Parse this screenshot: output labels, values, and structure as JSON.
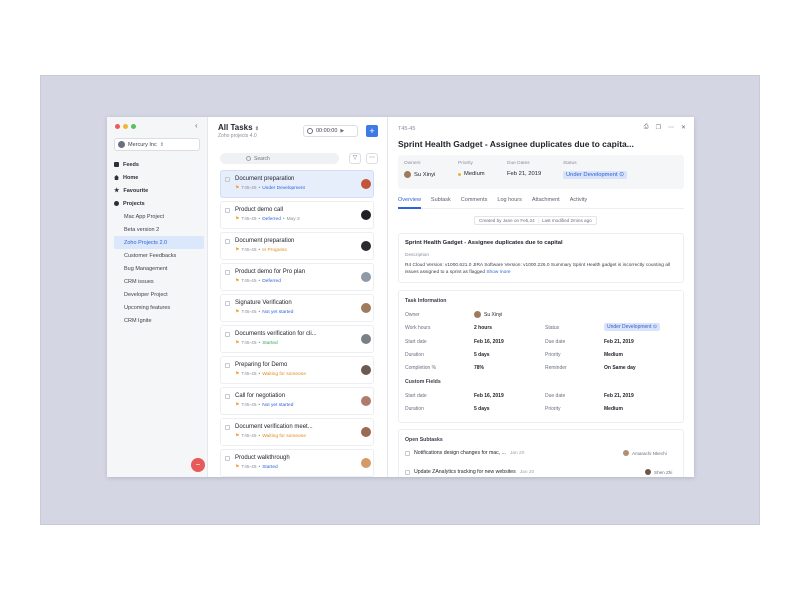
{
  "sidebar": {
    "org_name": "Mercury Inc",
    "nav": [
      {
        "label": "Feeds",
        "icon": "feeds-icon"
      },
      {
        "label": "Home",
        "icon": "home-icon"
      },
      {
        "label": "Favourite",
        "icon": "star-icon"
      },
      {
        "label": "Projects",
        "icon": "projects-icon"
      }
    ],
    "projects": [
      "Mac App Project",
      "Beta version 2",
      "Zoho Projects 2.0",
      "Customer Feedbacks",
      "Bug Management",
      "CRM issues",
      "Developer Project",
      "Upcoming features",
      "CRM Ignite"
    ],
    "active_project": "Zoho Projects 2.0"
  },
  "tasklist": {
    "title": "All Tasks",
    "subtitle": "Zoho projects 4.0",
    "timer": "00:00:00",
    "search_placeholder": "Search",
    "tasks": [
      {
        "name": "Document preparation",
        "id": "T45-45",
        "status": "Under Development",
        "status_color": "#2d63d9"
      },
      {
        "name": "Product demo call",
        "id": "T45-45",
        "status": "Deferred",
        "extra": "May 3",
        "status_color": "#2d63d9"
      },
      {
        "name": "Document preparation",
        "id": "T45-45",
        "status": "In Progress",
        "status_color": "#e08a1e"
      },
      {
        "name": "Product demo for Pro plan",
        "id": "T45-45",
        "status": "Deferred",
        "status_color": "#2d63d9"
      },
      {
        "name": "Signature Verification",
        "id": "T45-45",
        "status": "Not yet started",
        "status_color": "#2d63d9"
      },
      {
        "name": "Documents verification for cli...",
        "id": "T45-45",
        "status": "Started",
        "status_color": "#3aa65a"
      },
      {
        "name": "Preparing for Demo",
        "id": "T45-45",
        "status": "Waiting for someone",
        "status_color": "#e08a1e"
      },
      {
        "name": "Call for negotiation",
        "id": "T45-45",
        "status": "Not yet started",
        "status_color": "#2d63d9"
      },
      {
        "name": "Document verification meet...",
        "id": "T45-45",
        "status": "Waiting for someone",
        "status_color": "#e08a1e"
      },
      {
        "name": "Product walkthrough",
        "id": "T45-45",
        "status": "Started",
        "status_color": "#2d63d9"
      }
    ]
  },
  "detail": {
    "id": "T45-45",
    "title": "Sprint Health Gadget - Assignee duplicates due to capita...",
    "owner_label": "Owners",
    "owner": "Su Xinyi",
    "priority_label": "Priority",
    "priority": "Medium",
    "due_label": "Due Dates",
    "due": "Feb 21, 2019",
    "status_label": "Status",
    "status": "Under Development",
    "tabs": [
      "Overview",
      "Subtask",
      "Comments",
      "Log hours",
      "Attachment",
      "Activity"
    ],
    "created_by": "Created by Jane on Feb,24",
    "last_modified": "Last modified 2mins ago",
    "desc_title": "Sprint Health Gadget - Assignee duplicates due to capital",
    "desc_label": "Description",
    "desc_text": "R4 Cloud Version: v1000.621.0 JIRA Software Version: v1000.226.0 Summary Sprint Health gadget is incorrectly counting all issues assigned to a sprint as flagged",
    "show_more": "Show more",
    "task_info_title": "Task Information",
    "info": {
      "owner_l": "Owner",
      "owner_v": "Su Xinyi",
      "work_l": "Work hours",
      "work_v": "2 hours",
      "status_l": "Status",
      "status_v": "Under Development",
      "start_l": "Start date",
      "start_v": "Feb 16, 2019",
      "due_l": "Due date",
      "due_v": "Feb 21, 2019",
      "dur_l": "Duration",
      "dur_v": "5 days",
      "prio_l": "Priority",
      "prio_v": "Medium",
      "comp_l": "Completion %",
      "comp_v": "78%",
      "rem_l": "Reminder",
      "rem_v": "On Same day"
    },
    "custom_title": "Custom Fields",
    "custom": {
      "start_l": "Start date",
      "start_v": "Feb 16, 2019",
      "due_l": "Due date",
      "due_v": "Feb 21, 2019",
      "dur_l": "Duration",
      "dur_v": "5 days",
      "prio_l": "Priority",
      "prio_v": "Medium"
    },
    "open_subtasks_title": "Open Subtasks",
    "subtasks": [
      {
        "name": "Notifications design changes for mac, ...",
        "date": "Jan 20",
        "owner": "Amarachi Nkechi"
      },
      {
        "name": "Update ZAnalytics tracking for new websites",
        "date": "Jan 20",
        "owner": "Shen Zhi"
      }
    ]
  },
  "colors": {
    "accent": "#2d63d9",
    "fab": "#e75a5a",
    "traffic_red": "#ee5b5b",
    "traffic_yellow": "#f2b53a",
    "traffic_green": "#57c15f"
  }
}
